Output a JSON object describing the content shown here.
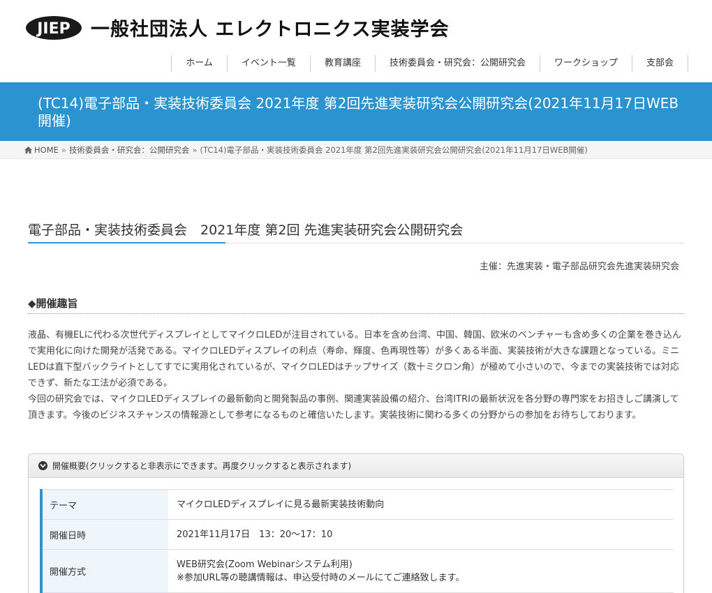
{
  "header": {
    "logo_text": "JIEP",
    "org_name": "一般社団法人 エレクトロニクス実装学会"
  },
  "nav": {
    "items": [
      {
        "label": "ホーム"
      },
      {
        "label": "イベント一覧"
      },
      {
        "label": "教育講座"
      },
      {
        "label": "技術委員会・研究会：公開研究会"
      },
      {
        "label": "ワークショップ"
      },
      {
        "label": "支部会"
      }
    ]
  },
  "page_title": "(TC14)電子部品・実装技術委員会 2021年度 第2回先進実装研究会公開研究会(2021年11月17日WEB開催)",
  "breadcrumb": {
    "home": "HOME",
    "sep": "»",
    "category": "技術委員会・研究会：公開研究会",
    "current": "(TC14)電子部品・実装技術委員会 2021年度 第2回先進実装研究会公開研究会(2021年11月17日WEB開催)"
  },
  "article": {
    "heading": "電子部品・実装技術委員会　2021年度 第2回 先進実装研究会公開研究会",
    "organizer": "主催：先進実装・電子部品研究会先進実装研究会",
    "section_title": "◆開催趣旨",
    "paragraph1": "液晶、有機ELに代わる次世代ディスプレイとしてマイクロLEDが注目されている。日本を含め台湾、中国、韓国、欧米のベンチャーも含め多くの企業を巻き込んで実用化に向けた開発が活発である。マイクロLEDディスプレイの利点（寿命、輝度、色再現性等）が多くある半面、実装技術が大きな課題となっている。ミニLEDは直下型バックライトとしてすでに実用化されているが、マイクロLEDはチップサイズ（数十ミクロン角）が極めて小さいので、今までの実装技術では対応できず、新たな工法が必須である。",
    "paragraph2": "今回の研究会では、マイクロLEDディスプレイの最新動向と開発製品の事例、関連実装設備の紹介、台湾ITRIの最新状況を各分野の専門家をお招きしご講演して頂きます。今後のビジネスチャンスの情報源として参考になるものと確信いたします。実装技術に関わる多くの分野からの参加をお待ちしております。"
  },
  "accordion": {
    "header": "開催概要(クリックすると非表示にできます。再度クリックすると表示されます)",
    "rows": [
      {
        "label": "テーマ",
        "value": "マイクロLEDディスプレイに見る最新実装技術動向",
        "note": ""
      },
      {
        "label": "開催日時",
        "value": "2021年11月17日　13：20〜17：10",
        "note": ""
      },
      {
        "label": "開催方式",
        "value": "WEB研究会(Zoom Webinarシステム利用)",
        "note": "※参加URL等の聴講情報は、申込受付時のメールにてご連絡致します。"
      }
    ]
  },
  "colors": {
    "accent": "#2a93d0",
    "table_header_bg": "#eef5fb"
  }
}
